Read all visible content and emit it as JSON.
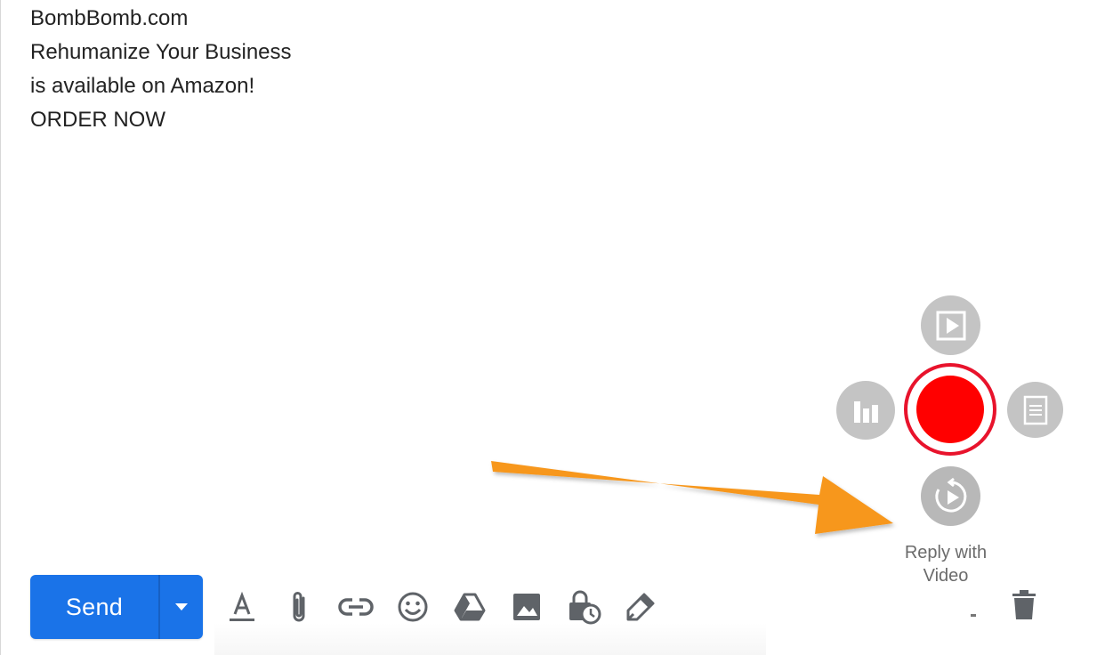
{
  "signature": {
    "line1": "BombBomb.com",
    "line2": "Rehumanize Your Business",
    "line3": "is available on Amazon!",
    "line4": "ORDER NOW"
  },
  "compose_toolbar": {
    "send_label": "Send",
    "more_send_options_icon": "caret-down-icon",
    "icons": [
      "formatting-options-icon",
      "attach-file-icon",
      "insert-link-icon",
      "insert-emoji-icon",
      "google-drive-icon",
      "insert-photo-icon",
      "confidential-mode-icon",
      "signature-pen-icon"
    ],
    "discard_icon": "trash-icon"
  },
  "bombbomb_widget": {
    "reply_label": "Reply with Video",
    "buttons": [
      "play-video-icon",
      "analytics-bars-icon",
      "record-video-button",
      "document-icon",
      "replay-video-icon"
    ],
    "record_ring_color": "#e8132c",
    "record_dot_color": "#ff0000"
  },
  "colors": {
    "send_blue": "#1a73e8",
    "arrow_orange": "#f7971e",
    "widget_gray": "#c4c4c4"
  }
}
